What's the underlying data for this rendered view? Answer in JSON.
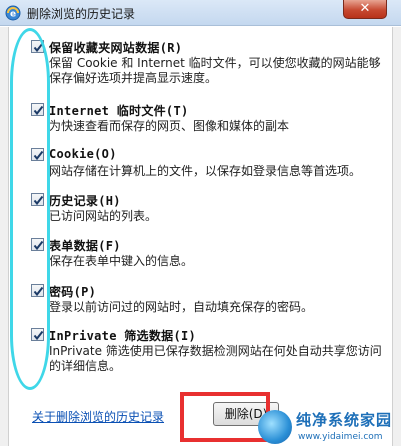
{
  "window": {
    "title": "删除浏览的历史记录",
    "close_label": "✕"
  },
  "options": [
    {
      "title": "保留收藏夹网站数据(R)",
      "description": "保留 Cookie 和 Internet 临时文件，可以使您收藏的网站能够保存偏好选项并提高显示速度。",
      "checked": true
    },
    {
      "title": "Internet 临时文件(T)",
      "description": "为快速查看而保存的网页、图像和媒体的副本",
      "checked": true
    },
    {
      "title": "Cookie(O)",
      "description": "网站存储在计算机上的文件，以保存如登录信息等首选项。",
      "checked": true
    },
    {
      "title": "历史记录(H)",
      "description": "已访问网站的列表。",
      "checked": true
    },
    {
      "title": "表单数据(F)",
      "description": "保存在表单中键入的信息。",
      "checked": true
    },
    {
      "title": "密码(P)",
      "description": "登录以前访问过的网站时，自动填充保存的密码。",
      "checked": true
    },
    {
      "title": "InPrivate 筛选数据(I)",
      "description": "InPrivate 筛选使用已保存数据检测网站在何处自动共享您访问的详细信息。",
      "checked": true
    }
  ],
  "footer": {
    "help_link": "关于删除浏览的历史记录",
    "delete_button": "删除(D)"
  },
  "watermark": {
    "name": "纯净系统家园",
    "url": "www.yidaimei.com"
  },
  "colors": {
    "annotation_oval": "#3fd7e8",
    "annotation_box": "#e83030",
    "link": "#0a50b4"
  }
}
